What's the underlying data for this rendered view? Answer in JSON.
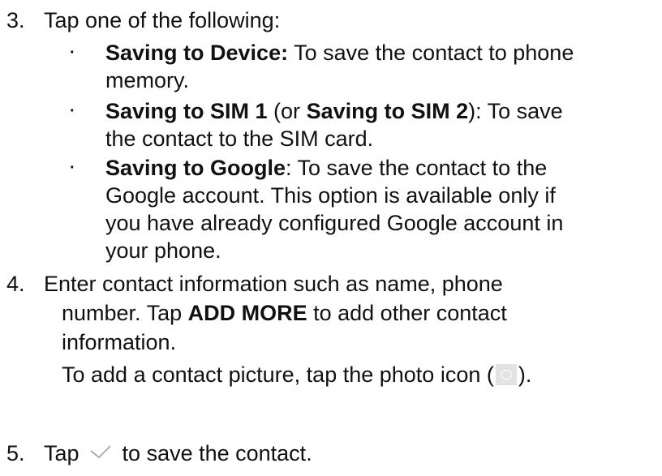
{
  "steps": [
    {
      "number": "3.",
      "text": "Tap one of the following:",
      "options": [
        {
          "bold1": "Saving to Device:",
          "text1": " To save the contact to phone",
          "line2": "memory."
        },
        {
          "bold1": "Saving to SIM 1",
          "text1": " (or ",
          "bold2": "Saving to SIM 2",
          "text2": "): To save",
          "line2": "the contact to the SIM card."
        },
        {
          "bold1": "Saving to Google",
          "text1": ": To save the contact to the",
          "line2": "Google account. This option is available only if",
          "line3": "you have already configured Google account in",
          "line4": "your phone."
        }
      ]
    },
    {
      "number": "4.",
      "line1": "Enter contact information such as name, phone",
      "line2_pre": "number. Tap ",
      "line2_bold": "ADD MORE",
      "line2_post": " to add other contact",
      "line3": "information.",
      "line4_pre": "To add a contact picture, tap the photo icon (",
      "line4_icon": "photo-icon",
      "line4_post": ")."
    },
    {
      "number": "5.",
      "pre": "Tap ",
      "icon": "checkmark-icon",
      "post": " to save the contact."
    }
  ]
}
